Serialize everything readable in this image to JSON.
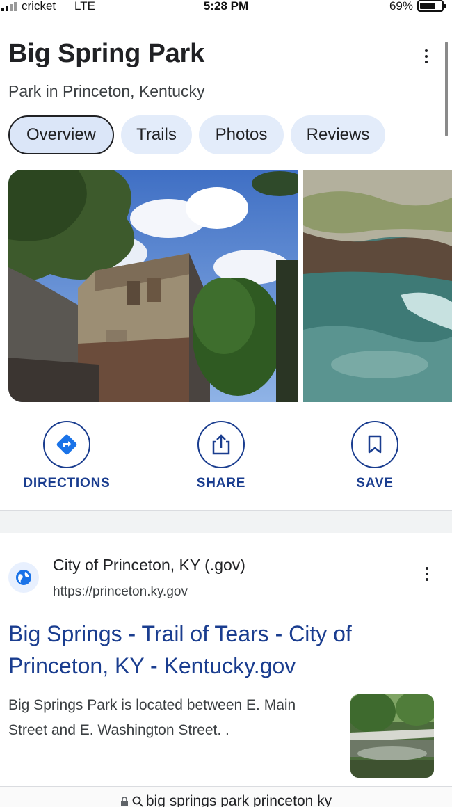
{
  "status_bar": {
    "carrier": "cricket",
    "network": "LTE",
    "time": "5:28 PM",
    "battery_percent": "69%",
    "battery_level": 0.69
  },
  "place": {
    "title": "Big Spring Park",
    "subtitle": "Park in Princeton, Kentucky"
  },
  "tabs": [
    {
      "label": "Overview",
      "active": true
    },
    {
      "label": "Trails",
      "active": false
    },
    {
      "label": "Photos",
      "active": false
    },
    {
      "label": "Reviews",
      "active": false
    }
  ],
  "actions": {
    "directions": {
      "label": "DIRECTIONS",
      "icon": "directions-icon"
    },
    "share": {
      "label": "SHARE",
      "icon": "share-icon"
    },
    "save": {
      "label": "SAVE",
      "icon": "bookmark-icon"
    }
  },
  "result": {
    "site_name": "City of Princeton, KY (.gov)",
    "url": "https://princeton.ky.gov",
    "title": "Big Springs - Trail of Tears - City of Princeton, KY - Kentucky.gov",
    "snippet": "Big Springs Park is located between E. Main Street and E. Washington Street. ."
  },
  "url_bar": {
    "query": "big springs park princeton ky"
  },
  "colors": {
    "accent": "#1a3d8f",
    "tab_background": "#e3ecfa",
    "directions_icon": "#1a73e8"
  }
}
